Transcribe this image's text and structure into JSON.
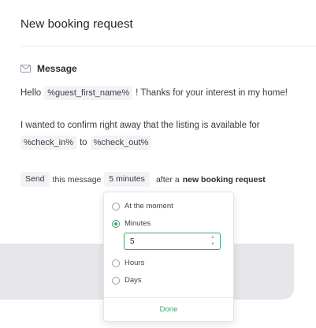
{
  "header": {
    "title": "New booking request"
  },
  "message": {
    "label": "Message",
    "icon": "envelope-icon",
    "line1": {
      "before": "Hello",
      "var": "%guest_first_name%",
      "after": "! Thanks for your interest in my home!"
    },
    "line2": "I wanted to confirm right away that the listing is available for",
    "line3": {
      "var1": "%check_in%",
      "between": "to",
      "var2": "%check_out%"
    }
  },
  "schedule": {
    "send_label": "Send",
    "text1": "this message",
    "delay_value": "5 minutes",
    "text2": "after a",
    "trigger": "new booking request"
  },
  "dropdown": {
    "options": [
      {
        "label": "At the moment",
        "selected": false
      },
      {
        "label": "Minutes",
        "selected": true
      },
      {
        "label": "Hours",
        "selected": false
      },
      {
        "label": "Days",
        "selected": false
      }
    ],
    "input_value": "5",
    "done_label": "Done"
  },
  "colors": {
    "accent": "#3aa56b",
    "chip_bg": "#f3f3f6",
    "panel_gray": "#e7e6ea"
  }
}
